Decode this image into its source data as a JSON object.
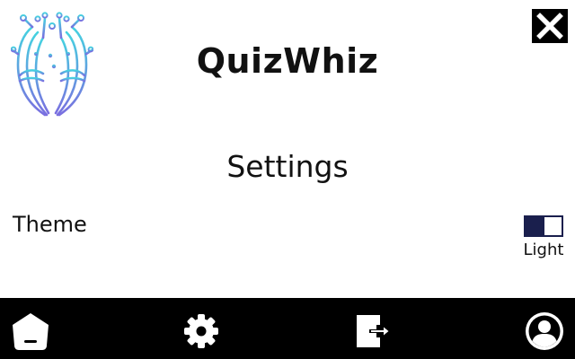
{
  "header": {
    "app_title": "QuizWhiz",
    "logo_icon": "brain-circuit-logo-icon",
    "close_icon": "close-icon"
  },
  "main": {
    "page_title": "Settings",
    "settings": [
      {
        "label": "Theme",
        "toggle_state": "Light",
        "toggle_icon": "toggle-switch-icon"
      }
    ]
  },
  "navbar": {
    "items": [
      {
        "id": "home",
        "icon": "home-icon"
      },
      {
        "id": "settings",
        "icon": "gear-icon"
      },
      {
        "id": "logout",
        "icon": "logout-icon"
      },
      {
        "id": "profile",
        "icon": "user-profile-icon"
      }
    ]
  },
  "colors": {
    "background": "#ffffff",
    "navbar": "#000000",
    "toggle_accent": "#1a1f4d",
    "logo_gradient_top": "#45d3e0",
    "logo_gradient_bottom": "#7a6fe0"
  }
}
